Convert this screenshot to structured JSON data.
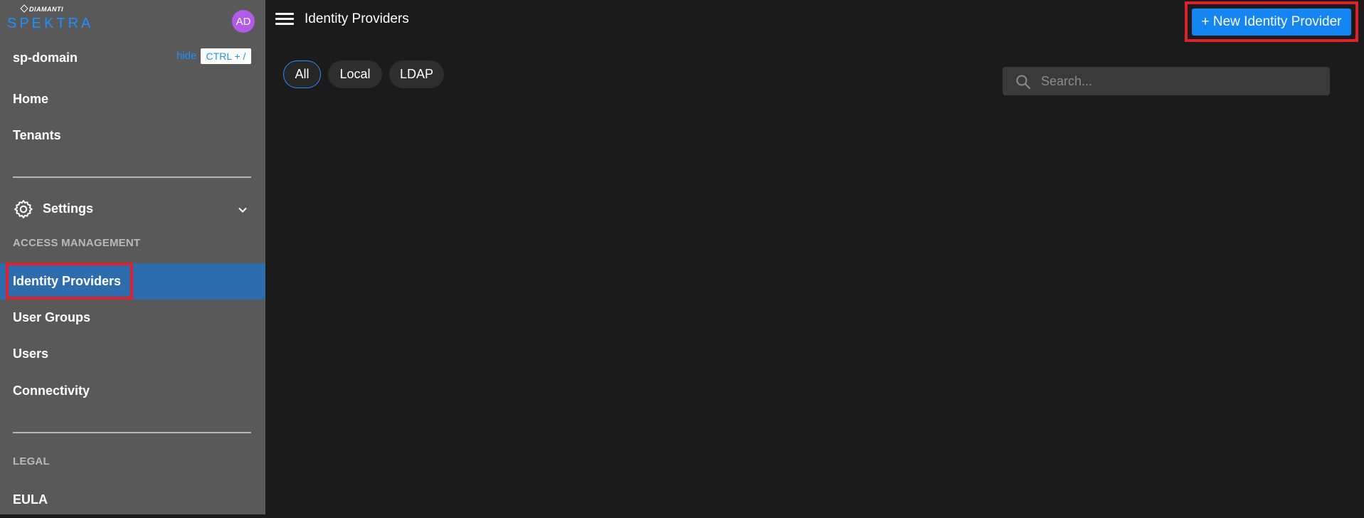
{
  "brand": {
    "company": "DIAMANTI",
    "product": "SPEKTRA"
  },
  "user": {
    "initials": "AD",
    "avatar_color": "#b15be8"
  },
  "sidebar": {
    "domain": "sp-domain",
    "hide_label": "hide",
    "shortcut": "CTRL + /",
    "top_items": [
      {
        "label": "Home"
      },
      {
        "label": "Tenants"
      }
    ],
    "settings_label": "Settings",
    "access_section_label": "ACCESS MANAGEMENT",
    "access_items": [
      {
        "label": "Identity Providers",
        "active": true
      },
      {
        "label": "User Groups"
      },
      {
        "label": "Users"
      },
      {
        "label": "Connectivity"
      }
    ],
    "legal_section_label": "LEGAL",
    "legal_items": [
      {
        "label": "EULA"
      }
    ],
    "icons": {
      "settings": "gear-icon",
      "expand": "chevron-down-icon"
    }
  },
  "header": {
    "menu_icon": "hamburger-icon",
    "title": "Identity Providers",
    "new_button_label": "+ New Identity Provider"
  },
  "filters": {
    "chips": [
      {
        "label": "All",
        "selected": true
      },
      {
        "label": "Local"
      },
      {
        "label": "LDAP"
      }
    ]
  },
  "search": {
    "placeholder": "Search...",
    "value": "",
    "icon": "search-icon"
  },
  "colors": {
    "sidebar_bg": "#595959",
    "main_bg": "#1b1b1b",
    "accent": "#1585f2",
    "active_item_bg": "#2e6dad",
    "highlight_outline": "#e0202a"
  }
}
